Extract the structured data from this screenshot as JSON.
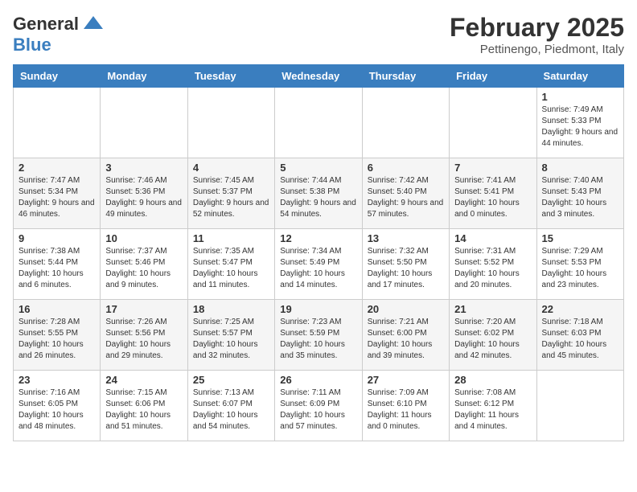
{
  "logo": {
    "general": "General",
    "blue": "Blue"
  },
  "title": "February 2025",
  "subtitle": "Pettinengo, Piedmont, Italy",
  "days_of_week": [
    "Sunday",
    "Monday",
    "Tuesday",
    "Wednesday",
    "Thursday",
    "Friday",
    "Saturday"
  ],
  "weeks": [
    [
      {
        "day": "",
        "info": ""
      },
      {
        "day": "",
        "info": ""
      },
      {
        "day": "",
        "info": ""
      },
      {
        "day": "",
        "info": ""
      },
      {
        "day": "",
        "info": ""
      },
      {
        "day": "",
        "info": ""
      },
      {
        "day": "1",
        "info": "Sunrise: 7:49 AM\nSunset: 5:33 PM\nDaylight: 9 hours and 44 minutes."
      }
    ],
    [
      {
        "day": "2",
        "info": "Sunrise: 7:47 AM\nSunset: 5:34 PM\nDaylight: 9 hours and 46 minutes."
      },
      {
        "day": "3",
        "info": "Sunrise: 7:46 AM\nSunset: 5:36 PM\nDaylight: 9 hours and 49 minutes."
      },
      {
        "day": "4",
        "info": "Sunrise: 7:45 AM\nSunset: 5:37 PM\nDaylight: 9 hours and 52 minutes."
      },
      {
        "day": "5",
        "info": "Sunrise: 7:44 AM\nSunset: 5:38 PM\nDaylight: 9 hours and 54 minutes."
      },
      {
        "day": "6",
        "info": "Sunrise: 7:42 AM\nSunset: 5:40 PM\nDaylight: 9 hours and 57 minutes."
      },
      {
        "day": "7",
        "info": "Sunrise: 7:41 AM\nSunset: 5:41 PM\nDaylight: 10 hours and 0 minutes."
      },
      {
        "day": "8",
        "info": "Sunrise: 7:40 AM\nSunset: 5:43 PM\nDaylight: 10 hours and 3 minutes."
      }
    ],
    [
      {
        "day": "9",
        "info": "Sunrise: 7:38 AM\nSunset: 5:44 PM\nDaylight: 10 hours and 6 minutes."
      },
      {
        "day": "10",
        "info": "Sunrise: 7:37 AM\nSunset: 5:46 PM\nDaylight: 10 hours and 9 minutes."
      },
      {
        "day": "11",
        "info": "Sunrise: 7:35 AM\nSunset: 5:47 PM\nDaylight: 10 hours and 11 minutes."
      },
      {
        "day": "12",
        "info": "Sunrise: 7:34 AM\nSunset: 5:49 PM\nDaylight: 10 hours and 14 minutes."
      },
      {
        "day": "13",
        "info": "Sunrise: 7:32 AM\nSunset: 5:50 PM\nDaylight: 10 hours and 17 minutes."
      },
      {
        "day": "14",
        "info": "Sunrise: 7:31 AM\nSunset: 5:52 PM\nDaylight: 10 hours and 20 minutes."
      },
      {
        "day": "15",
        "info": "Sunrise: 7:29 AM\nSunset: 5:53 PM\nDaylight: 10 hours and 23 minutes."
      }
    ],
    [
      {
        "day": "16",
        "info": "Sunrise: 7:28 AM\nSunset: 5:55 PM\nDaylight: 10 hours and 26 minutes."
      },
      {
        "day": "17",
        "info": "Sunrise: 7:26 AM\nSunset: 5:56 PM\nDaylight: 10 hours and 29 minutes."
      },
      {
        "day": "18",
        "info": "Sunrise: 7:25 AM\nSunset: 5:57 PM\nDaylight: 10 hours and 32 minutes."
      },
      {
        "day": "19",
        "info": "Sunrise: 7:23 AM\nSunset: 5:59 PM\nDaylight: 10 hours and 35 minutes."
      },
      {
        "day": "20",
        "info": "Sunrise: 7:21 AM\nSunset: 6:00 PM\nDaylight: 10 hours and 39 minutes."
      },
      {
        "day": "21",
        "info": "Sunrise: 7:20 AM\nSunset: 6:02 PM\nDaylight: 10 hours and 42 minutes."
      },
      {
        "day": "22",
        "info": "Sunrise: 7:18 AM\nSunset: 6:03 PM\nDaylight: 10 hours and 45 minutes."
      }
    ],
    [
      {
        "day": "23",
        "info": "Sunrise: 7:16 AM\nSunset: 6:05 PM\nDaylight: 10 hours and 48 minutes."
      },
      {
        "day": "24",
        "info": "Sunrise: 7:15 AM\nSunset: 6:06 PM\nDaylight: 10 hours and 51 minutes."
      },
      {
        "day": "25",
        "info": "Sunrise: 7:13 AM\nSunset: 6:07 PM\nDaylight: 10 hours and 54 minutes."
      },
      {
        "day": "26",
        "info": "Sunrise: 7:11 AM\nSunset: 6:09 PM\nDaylight: 10 hours and 57 minutes."
      },
      {
        "day": "27",
        "info": "Sunrise: 7:09 AM\nSunset: 6:10 PM\nDaylight: 11 hours and 0 minutes."
      },
      {
        "day": "28",
        "info": "Sunrise: 7:08 AM\nSunset: 6:12 PM\nDaylight: 11 hours and 4 minutes."
      },
      {
        "day": "",
        "info": ""
      }
    ]
  ]
}
